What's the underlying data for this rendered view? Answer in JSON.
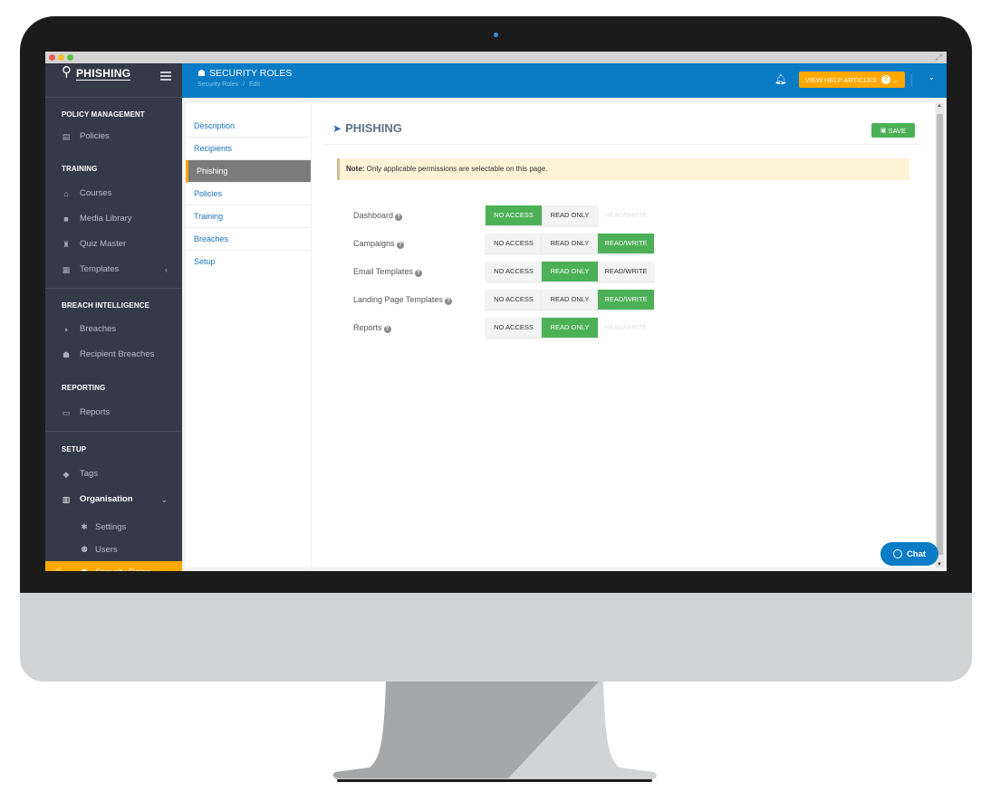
{
  "window": {
    "controls": [
      "close",
      "minimize",
      "maximize"
    ],
    "expand_icon": "expand-icon"
  },
  "brand": {
    "logo_text": "PHISHING",
    "logo_icon": "hook-icon"
  },
  "sidebar": {
    "sections": [
      {
        "label": "POLICY MANAGEMENT",
        "items": [
          {
            "label": "Policies",
            "icon": "clipboard-icon",
            "glyph": "▤"
          }
        ]
      },
      {
        "label": "TRAINING",
        "items": [
          {
            "label": "Courses",
            "icon": "graduation-cap-icon",
            "glyph": "⌂"
          },
          {
            "label": "Media Library",
            "icon": "video-icon",
            "glyph": "■"
          },
          {
            "label": "Quiz Master",
            "icon": "user-graduate-icon",
            "glyph": "♜"
          },
          {
            "label": "Templates",
            "icon": "file-image-icon",
            "glyph": "▦",
            "chevron": "‹"
          }
        ]
      },
      {
        "label": "BREACH INTELLIGENCE",
        "items": [
          {
            "label": "Breaches",
            "icon": "shield-icon",
            "glyph": "◗"
          },
          {
            "label": "Recipient Breaches",
            "icon": "user-shield-icon",
            "glyph": "☗"
          }
        ]
      },
      {
        "label": "REPORTING",
        "items": [
          {
            "label": "Reports",
            "icon": "print-icon",
            "glyph": "▭"
          }
        ]
      },
      {
        "label": "SETUP",
        "items": [
          {
            "label": "Tags",
            "icon": "tags-icon",
            "glyph": "◆"
          },
          {
            "label": "Organisation",
            "icon": "building-icon",
            "glyph": "▥",
            "chevron": "⌄"
          }
        ],
        "subitems": [
          {
            "label": "Settings",
            "icon": "cog-icon",
            "glyph": "✱"
          },
          {
            "label": "Users",
            "icon": "users-icon",
            "glyph": "⚉"
          },
          {
            "label": "Security Roles",
            "icon": "user-lock-icon",
            "glyph": "☗",
            "active": true
          }
        ]
      }
    ]
  },
  "topbar": {
    "title": "SECURITY ROLES",
    "title_icon": "user-lock-icon",
    "breadcrumb": [
      "Security Roles",
      "Edit"
    ],
    "breadcrumb_sep": "/",
    "help_button": "VIEW HELP ARTICLES",
    "help_icon": "question-circle-icon"
  },
  "tabs": [
    {
      "label": "Description"
    },
    {
      "label": "Recipients"
    },
    {
      "label": "Phishing",
      "active": true
    },
    {
      "label": "Policies"
    },
    {
      "label": "Training"
    },
    {
      "label": "Breaches"
    },
    {
      "label": "Setup"
    }
  ],
  "main": {
    "title": "PHISHING",
    "title_icon": "paper-plane-icon",
    "save_label": "SAVE",
    "note_prefix": "Note:",
    "note_text": " Only applicable permissions are selectable on this page.",
    "options": [
      "NO ACCESS",
      "READ ONLY",
      "READ/WRITE"
    ],
    "permissions": [
      {
        "label": "Dashboard",
        "selected": "NO ACCESS",
        "disabled": [
          "READ/WRITE"
        ]
      },
      {
        "label": "Campaigns",
        "selected": "READ/WRITE",
        "disabled": []
      },
      {
        "label": "Email Templates",
        "selected": "READ ONLY",
        "disabled": []
      },
      {
        "label": "Landing Page Templates",
        "selected": "READ/WRITE",
        "disabled": []
      },
      {
        "label": "Reports",
        "selected": "READ ONLY",
        "disabled": [
          "READ/WRITE"
        ]
      }
    ]
  },
  "chat": {
    "label": "Chat",
    "icon": "chat-bubble-icon"
  },
  "colors": {
    "brand_blue": "#0a7bc5",
    "accent_orange": "#ffa800",
    "success_green": "#4cb156",
    "sidebar_bg": "#353a4a"
  }
}
